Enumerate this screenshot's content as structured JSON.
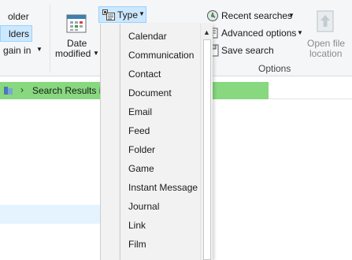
{
  "ribbon": {
    "left_group": {
      "folder_label": "older",
      "folders_label": "lders",
      "again_in_label": "gain in"
    },
    "date_modified": {
      "line1": "Date",
      "line2": "modified"
    },
    "type_button": {
      "label": "Type"
    },
    "options": {
      "recent_searches": "Recent searches",
      "advanced_options": "Advanced options",
      "save_search": "Save search",
      "open_file_location_line1": "Open file",
      "open_file_location_line2": "location",
      "group_label": "Options"
    }
  },
  "address_bar": {
    "text": "Search Results in",
    "progress": 0.763
  },
  "type_dropdown": {
    "items": [
      "Calendar",
      "Communication",
      "Contact",
      "Document",
      "Email",
      "Feed",
      "Folder",
      "Game",
      "Instant Message",
      "Journal",
      "Link",
      "Film"
    ]
  },
  "colors": {
    "ribbon_bg": "#f5f6f7",
    "selected_bg": "#cce8ff",
    "selected_border": "#99d1ff",
    "progress_green": "#87d87e",
    "row_highlight": "#e5f3ff",
    "menu_bg": "#f2f2f2"
  },
  "icons": {
    "type": "type-icon",
    "date_modified": "calendar-icon",
    "recent_searches": "recent-searches-icon",
    "advanced_options": "advanced-options-icon",
    "save_search": "save-search-icon",
    "open_file_location": "open-file-location-icon",
    "address": "folder-icon"
  }
}
